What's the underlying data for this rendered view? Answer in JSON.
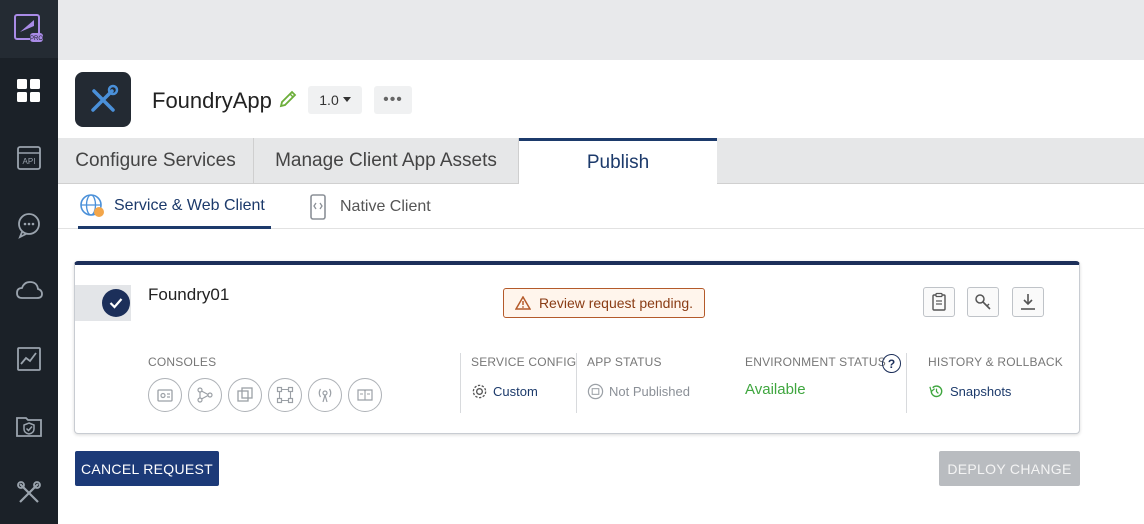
{
  "app": {
    "title": "FoundryApp",
    "version": "1.0",
    "more_label": "•••"
  },
  "nav": {
    "icons": [
      "foundry-logo-icon",
      "apps-grid-icon",
      "api-icon",
      "chat-icon",
      "cloud-icon",
      "analytics-icon",
      "security-folder-icon",
      "tools-icon"
    ]
  },
  "tabs": [
    {
      "label": "Configure Services",
      "active": false
    },
    {
      "label": "Manage Client App Assets",
      "active": false
    },
    {
      "label": "Publish",
      "active": true
    }
  ],
  "subtabs": [
    {
      "label": "Service & Web Client",
      "active": true
    },
    {
      "label": "Native Client",
      "active": false
    }
  ],
  "environment": {
    "name": "Foundry01",
    "status_badge": "Review request pending.",
    "columns": {
      "consoles": {
        "label": "CONSOLES"
      },
      "service_config": {
        "label": "SERVICE CONFIG",
        "value": "Custom"
      },
      "app_status": {
        "label": "APP STATUS",
        "value": "Not Published"
      },
      "environment_status": {
        "label": "ENVIRONMENT STATUS",
        "value": "Available",
        "help": "?"
      },
      "history": {
        "label": "HISTORY & ROLLBACK",
        "value": "Snapshots"
      }
    },
    "actions": [
      "clipboard-icon",
      "key-icon",
      "download-icon"
    ]
  },
  "buttons": {
    "cancel": "CANCEL REQUEST",
    "deploy": "DEPLOY CHANGE"
  },
  "colors": {
    "nav_bg": "#1b2128",
    "accent": "#1c3a6b",
    "available": "#3fa63f",
    "badge_border": "#b45a2a",
    "disabled": "#b9bcc0"
  }
}
